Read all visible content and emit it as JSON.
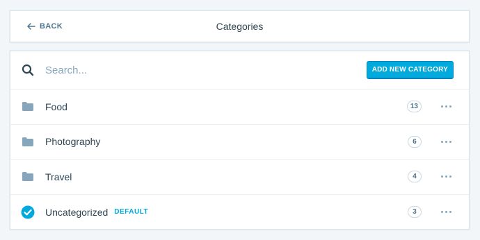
{
  "header": {
    "back_label": "BACK",
    "title": "Categories"
  },
  "search": {
    "placeholder": "Search...",
    "value": ""
  },
  "add_button_label": "ADD NEW CATEGORY",
  "categories": [
    {
      "name": "Food",
      "count": "13",
      "icon": "folder-icon"
    },
    {
      "name": "Photography",
      "count": "6",
      "icon": "folder-icon"
    },
    {
      "name": "Travel",
      "count": "4",
      "icon": "folder-icon"
    },
    {
      "name": "Uncategorized",
      "count": "3",
      "icon": "checkmark-circle-icon",
      "badge": "DEFAULT"
    }
  ],
  "colors": {
    "accent": "#00aadc",
    "folder": "#87a6bc",
    "text": "#2e4453"
  }
}
